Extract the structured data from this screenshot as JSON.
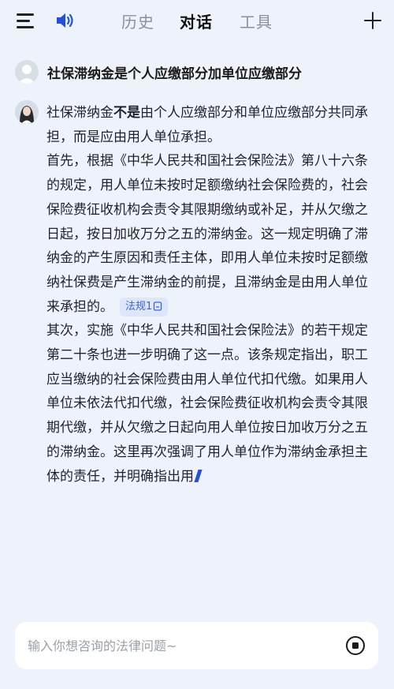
{
  "header": {
    "tabs": [
      {
        "label": "历史",
        "active": false
      },
      {
        "label": "对话",
        "active": true
      },
      {
        "label": "工具",
        "active": false
      }
    ],
    "icons": {
      "menu": "menu-icon",
      "speaker": "speaker-icon",
      "new": "plus-icon"
    },
    "accent_color": "#2450d6"
  },
  "conversation": {
    "question": "社保滞纳金是个人应缴部分加单位应缴部分",
    "answer": {
      "intro_prefix": "社保滞纳金",
      "intro_bold": "不是",
      "intro_rest": "由个人应缴部分和单位应缴部分共同承担，而是应由用人单位承担。",
      "para1": "首先，根据《中华人民共和国社会保险法》第八十六条的规定，用人单位未按时足额缴纳社会保险费的，社会保险费征收机构会责令其限期缴纳或补足，并从欠缴之日起，按日加收万分之五的滞纳金。这一规定明确了滞纳金的产生原因和责任主体，即用人单位未按时足额缴纳社保费是产生滞纳金的前提，且滞纳金是由用人单位来承担的。",
      "law_tag": "法规1",
      "para2": "其次，实施《中华人民共和国社会保险法》的若干规定第二十条也进一步明确了这一点。该条规定指出，职工应当缴纳的社会保险费由用人单位代扣代缴。如果用人单位未依法代扣代缴，社会保险费征收机构会责令其限期代缴，并从欠缴之日起向用人单位按日加收万分之五的滞纳金。这里再次强调了用人单位作为滞纳金承担主体的责任，并明确指出用"
    }
  },
  "input": {
    "placeholder": "输入你想咨询的法律问题~",
    "value": ""
  }
}
